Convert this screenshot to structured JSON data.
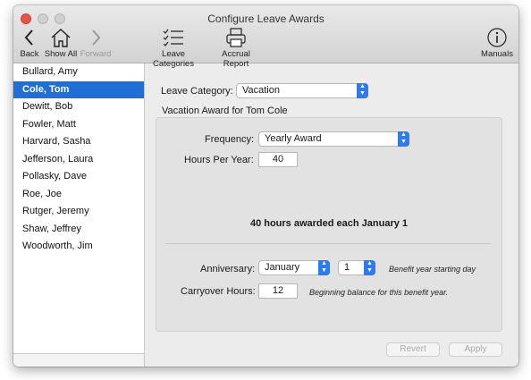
{
  "window": {
    "title": "Configure Leave Awards"
  },
  "toolbar": {
    "back": "Back",
    "show_all": "Show All",
    "forward": "Forward",
    "leave_categories": "Leave Categories",
    "accrual_report": "Accrual Report",
    "manuals": "Manuals"
  },
  "employees": [
    {
      "name": "Bullard, Amy"
    },
    {
      "name": "Cole, Tom",
      "selected": true
    },
    {
      "name": "Dewitt, Bob"
    },
    {
      "name": "Fowler, Matt"
    },
    {
      "name": "Harvard, Sasha"
    },
    {
      "name": "Jefferson, Laura"
    },
    {
      "name": "Pollasky, Dave"
    },
    {
      "name": "Roe, Joe"
    },
    {
      "name": "Rutger, Jeremy"
    },
    {
      "name": "Shaw, Jeffrey"
    },
    {
      "name": "Woodworth, Jim"
    }
  ],
  "form": {
    "leave_category_label": "Leave Category:",
    "leave_category_value": "Vacation",
    "award_heading": "Vacation Award for Tom Cole",
    "frequency_label": "Frequency:",
    "frequency_value": "Yearly Award",
    "hours_label": "Hours Per Year:",
    "hours_value": "40",
    "summary": "40 hours awarded each January 1",
    "anniversary_label": "Anniversary:",
    "anniversary_month": "January",
    "anniversary_day": "1",
    "anniversary_note": "Benefit year starting day",
    "carryover_label": "Carryover Hours:",
    "carryover_value": "12",
    "carryover_note": "Beginning balance for this benefit year."
  },
  "buttons": {
    "revert": "Revert",
    "apply": "Apply"
  },
  "colors": {
    "selection": "#1f6fd6",
    "stepper": "#2a7bf5"
  }
}
